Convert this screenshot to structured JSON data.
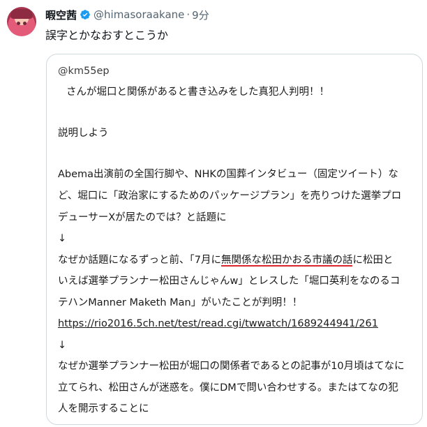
{
  "post": {
    "display_name": "暇空茜",
    "handle": "@himasoraakane",
    "separator": "·",
    "time": "9分",
    "text": "誤字とかなおすとこうか"
  },
  "quote": {
    "handle": "@km55ep",
    "line1": "さんが堀口と関係があると書き込みをした真犯人判明！！",
    "line2": "説明しよう",
    "line3": "Abema出演前の全国行脚や、NHKの国葬インタビュー（固定ツイート）な",
    "line4": "ど、堀口に「政治家にするためのパッケージプラン」を売りつけた選挙プロ",
    "line5": "デューサーXが居たのでは？と話題に",
    "arrow1": "↓",
    "line6_pre": "なぜか話題になるずっと前、「7月に",
    "line6_underlined": "無関係な松田かおる市議の話",
    "line6_post": "に松田と",
    "line7": "いえば選挙プランナー松田さんじゃんw」とレスした「堀口英利をなのるコ",
    "line8": "テハンManner Maketh Man」がいたことが判明！！",
    "link": "https://rio2016.5ch.net/test/read.cgi/twwatch/1689244941/261",
    "arrow2": "↓",
    "line9": "なぜか選挙プランナー松田が堀口の関係者であるとの記事が10月頃はてなに",
    "line10": "立てられ、松田さんが迷惑を。僕にDMで問い合わせする。またはてなの犯",
    "line11": "人を開示することに"
  },
  "colors": {
    "text": "#0f1419",
    "secondary": "#536471",
    "verified": "#1d9bf0",
    "border": "#cfd9de",
    "underline": "#d9262b"
  },
  "icons": {
    "verified": "verified-badge-icon"
  }
}
